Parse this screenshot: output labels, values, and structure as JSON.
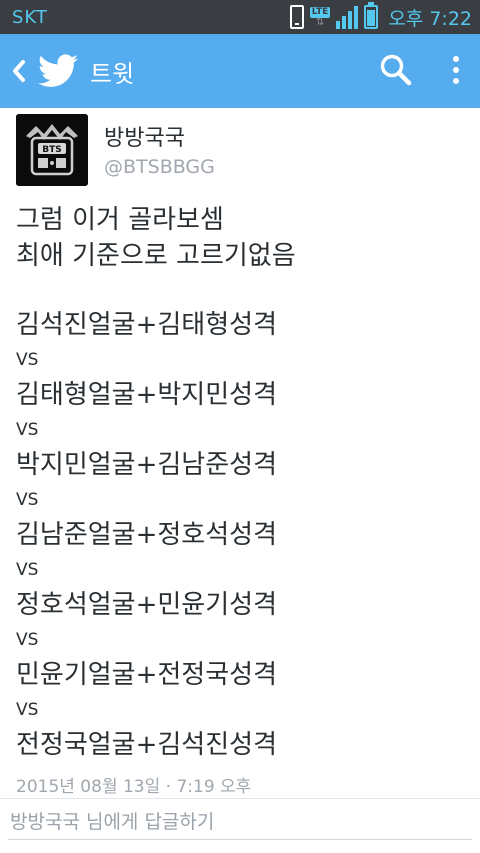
{
  "status_bar": {
    "carrier": "SKT",
    "network": "LTE",
    "time": "오후 7:22",
    "icons": [
      "phone-icon",
      "lte-icon",
      "signal-icon",
      "battery-icon"
    ]
  },
  "app_bar": {
    "title": "트윗",
    "color": "#55acee",
    "icons": [
      "back-icon",
      "twitter-bird-icon",
      "search-icon",
      "overflow-menu-icon"
    ]
  },
  "tweet": {
    "avatar_text": "BTS",
    "display_name": "방방국국",
    "handle": "@BTSBBGG",
    "intro": [
      "그럼 이거 골라보셈",
      "최애 기준으로 고르기없음"
    ],
    "combos": [
      "김석진얼굴+김태형성격",
      "김태형얼굴+박지민성격",
      "박지민얼굴+김남준성격",
      "김남준얼굴+정호석성격",
      "정호석얼굴+민윤기성격",
      "민윤기얼굴+전정국성격",
      "전정국얼굴+김석진성격"
    ],
    "vs_label": "VS",
    "timestamp": "2015년 08월 13일 · 7:19 오후"
  },
  "reply": {
    "placeholder": "방방국국 님에게 답글하기"
  }
}
